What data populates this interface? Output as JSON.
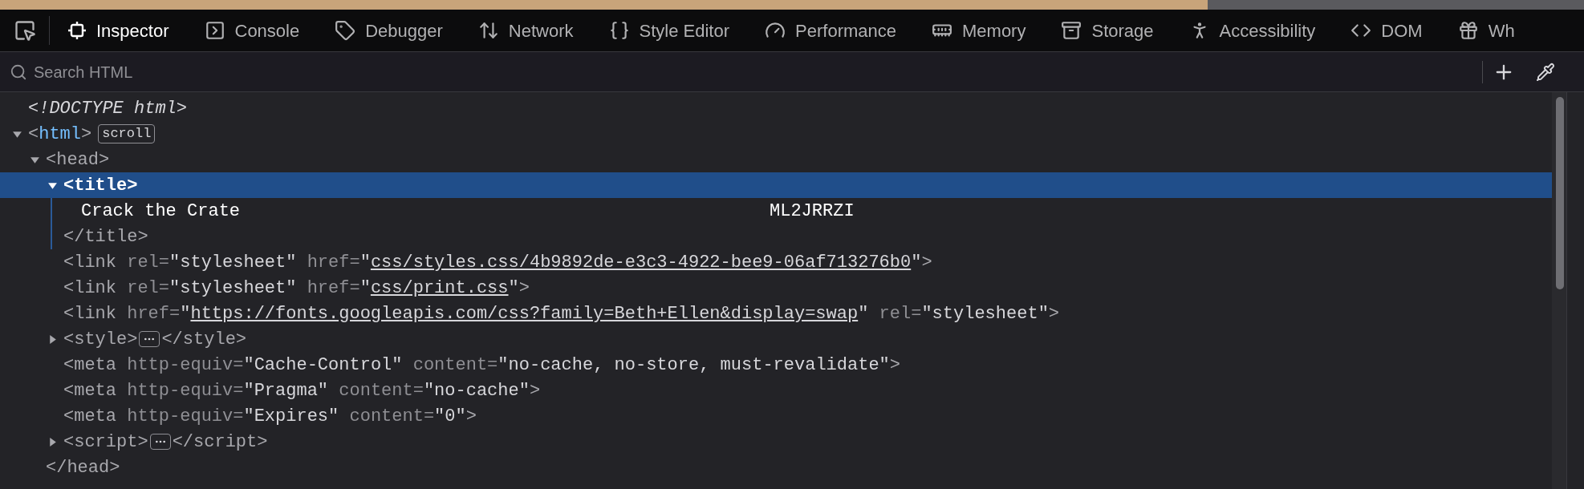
{
  "tabs": [
    {
      "label": "Inspector",
      "selected": true
    },
    {
      "label": "Console",
      "selected": false
    },
    {
      "label": "Debugger",
      "selected": false
    },
    {
      "label": "Network",
      "selected": false
    },
    {
      "label": "Style Editor",
      "selected": false
    },
    {
      "label": "Performance",
      "selected": false
    },
    {
      "label": "Memory",
      "selected": false
    },
    {
      "label": "Storage",
      "selected": false
    },
    {
      "label": "Accessibility",
      "selected": false
    },
    {
      "label": "DOM",
      "selected": false
    },
    {
      "label": "Wh",
      "selected": false
    }
  ],
  "search": {
    "placeholder": "Search HTML"
  },
  "tree": [
    {
      "kind": "doctype",
      "text": "<!DOCTYPE html>"
    },
    {
      "kind": "element",
      "expanded": true,
      "selected": false,
      "open": [
        {
          "kind": "tag",
          "text": "<"
        },
        {
          "kind": "name",
          "text": "html"
        },
        {
          "kind": "tag",
          "text": ">"
        }
      ],
      "badge": "scroll",
      "children": [
        {
          "kind": "element",
          "expanded": true,
          "selected": false,
          "open": [
            {
              "kind": "tag",
              "text": "<head>"
            }
          ],
          "close": [
            {
              "kind": "tag",
              "text": "</head>"
            }
          ],
          "children": [
            {
              "kind": "element",
              "expanded": true,
              "selected": true,
              "open": [
                {
                  "kind": "tag",
                  "text": "<title>"
                }
              ],
              "close": [
                {
                  "kind": "tag",
                  "text": "</title>"
                }
              ],
              "children": [
                {
                  "kind": "text",
                  "texts": [
                    "Crack the Crate",
                    "ML2JRRZI"
                  ]
                }
              ]
            },
            {
              "kind": "leaf",
              "open": [
                {
                  "kind": "tag",
                  "text": "<link"
                },
                {
                  "kind": "attr",
                  "text": " rel="
                },
                {
                  "kind": "value",
                  "text": "\"stylesheet\""
                },
                {
                  "kind": "attr",
                  "text": " href="
                },
                {
                  "kind": "value",
                  "text": "\""
                },
                {
                  "kind": "link",
                  "text": "css/styles.css/4b9892de-e3c3-4922-bee9-06af713276b0"
                },
                {
                  "kind": "value",
                  "text": "\""
                },
                {
                  "kind": "tag",
                  "text": ">"
                }
              ]
            },
            {
              "kind": "leaf",
              "open": [
                {
                  "kind": "tag",
                  "text": "<link"
                },
                {
                  "kind": "attr",
                  "text": " rel="
                },
                {
                  "kind": "value",
                  "text": "\"stylesheet\""
                },
                {
                  "kind": "attr",
                  "text": " href="
                },
                {
                  "kind": "value",
                  "text": "\""
                },
                {
                  "kind": "link",
                  "text": "css/print.css"
                },
                {
                  "kind": "value",
                  "text": "\""
                },
                {
                  "kind": "tag",
                  "text": ">"
                }
              ]
            },
            {
              "kind": "leaf",
              "open": [
                {
                  "kind": "tag",
                  "text": "<link"
                },
                {
                  "kind": "attr",
                  "text": " href="
                },
                {
                  "kind": "value",
                  "text": "\""
                },
                {
                  "kind": "link",
                  "text": "https://fonts.googleapis.com/css?family=Beth+Ellen&display=swap"
                },
                {
                  "kind": "value",
                  "text": "\""
                },
                {
                  "kind": "attr",
                  "text": " rel="
                },
                {
                  "kind": "value",
                  "text": "\"stylesheet\""
                },
                {
                  "kind": "tag",
                  "text": ">"
                }
              ]
            },
            {
              "kind": "element",
              "expanded": false,
              "selected": false,
              "open": [
                {
                  "kind": "tag",
                  "text": "<style>"
                }
              ],
              "close": [
                {
                  "kind": "tag",
                  "text": "</style>"
                }
              ]
            },
            {
              "kind": "leaf",
              "open": [
                {
                  "kind": "tag",
                  "text": "<meta"
                },
                {
                  "kind": "attr",
                  "text": " http-equiv="
                },
                {
                  "kind": "value",
                  "text": "\"Cache-Control\""
                },
                {
                  "kind": "attr",
                  "text": " content="
                },
                {
                  "kind": "value",
                  "text": "\"no-cache, no-store, must-revalidate\""
                },
                {
                  "kind": "tag",
                  "text": ">"
                }
              ]
            },
            {
              "kind": "leaf",
              "open": [
                {
                  "kind": "tag",
                  "text": "<meta"
                },
                {
                  "kind": "attr",
                  "text": " http-equiv="
                },
                {
                  "kind": "value",
                  "text": "\"Pragma\""
                },
                {
                  "kind": "attr",
                  "text": " content="
                },
                {
                  "kind": "value",
                  "text": "\"no-cache\""
                },
                {
                  "kind": "tag",
                  "text": ">"
                }
              ]
            },
            {
              "kind": "leaf",
              "open": [
                {
                  "kind": "tag",
                  "text": "<meta"
                },
                {
                  "kind": "attr",
                  "text": " http-equiv="
                },
                {
                  "kind": "value",
                  "text": "\"Expires\""
                },
                {
                  "kind": "attr",
                  "text": " content="
                },
                {
                  "kind": "value",
                  "text": "\"0\""
                },
                {
                  "kind": "tag",
                  "text": ">"
                }
              ]
            },
            {
              "kind": "element",
              "expanded": false,
              "selected": false,
              "open": [
                {
                  "kind": "tag",
                  "text": "<script>"
                }
              ],
              "close": [
                {
                  "kind": "tag",
                  "text": "</script>"
                }
              ]
            }
          ]
        }
      ]
    }
  ]
}
